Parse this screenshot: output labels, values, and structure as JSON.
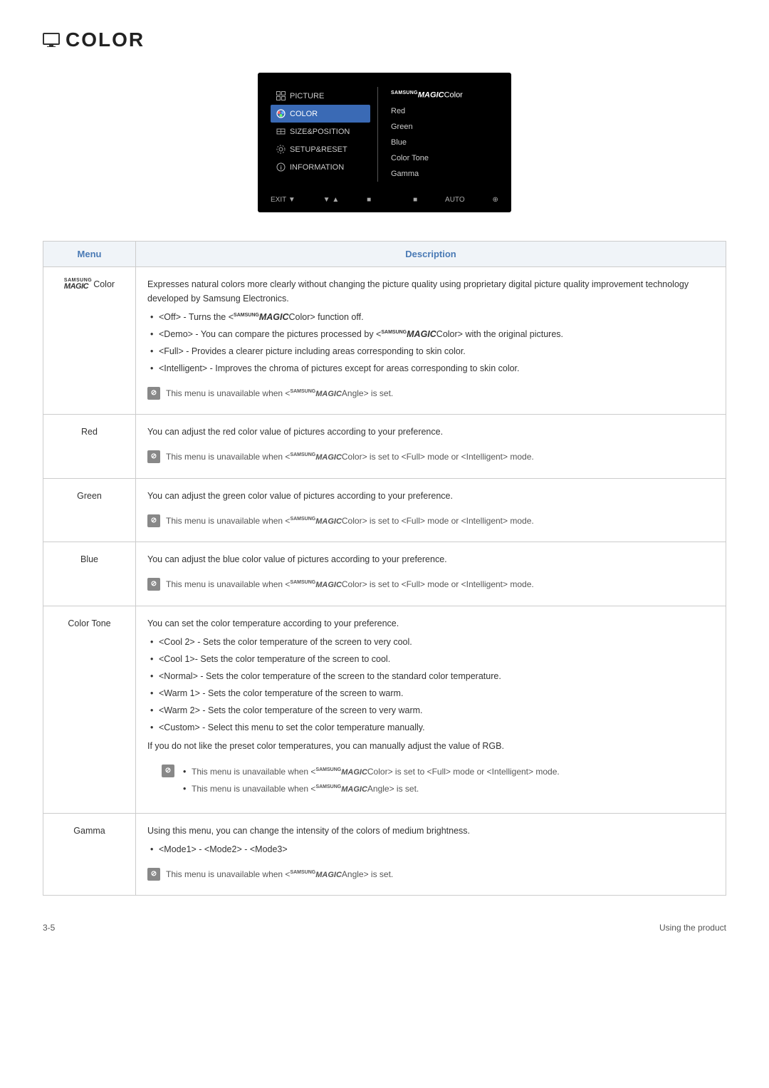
{
  "page": {
    "title": "COLOR",
    "footer_left": "3-5",
    "footer_right": "Using the product"
  },
  "osd": {
    "menu_items": [
      {
        "label": "PICTURE",
        "active": false,
        "icon": "grid"
      },
      {
        "label": "COLOR",
        "active": true,
        "icon": "color"
      },
      {
        "label": "SIZE&POSITION",
        "active": false,
        "icon": "size"
      },
      {
        "label": "SETUP&RESET",
        "active": false,
        "icon": "gear"
      },
      {
        "label": "INFORMATION",
        "active": false,
        "icon": "info"
      }
    ],
    "right_items": [
      {
        "label": "MAGICColor",
        "logo": true
      },
      {
        "label": "Red"
      },
      {
        "label": "Green"
      },
      {
        "label": "Blue"
      },
      {
        "label": "Color Tone"
      },
      {
        "label": "Gamma"
      }
    ]
  },
  "table": {
    "col_menu": "Menu",
    "col_desc": "Description",
    "rows": [
      {
        "menu": "MAGICColor",
        "menu_type": "magic_color",
        "desc_main": "Expresses natural colors more clearly without changing the picture quality using proprietary digital picture quality improvement technology developed by Samsung Electronics.",
        "bullets": [
          "<Off> - Turns the MAGICColor> function off.",
          "<Demo> - You can compare the pictures processed by MAGICColor> with the original pictures.",
          "<Full> - Provides a clearer picture including areas corresponding to skin color.",
          "<Intelligent> - Improves the chroma of pictures except for areas corresponding to skin color."
        ],
        "notes": [
          "This menu is unavailable when < MAGICAngle> is set."
        ]
      },
      {
        "menu": "Red",
        "desc_main": "You can adjust the red color value of pictures according to your preference.",
        "notes": [
          "This menu is unavailable when < MAGICColor> is set to <Full> mode or <Intelligent> mode."
        ]
      },
      {
        "menu": "Green",
        "desc_main": "You can adjust the green color value of pictures according to your preference.",
        "notes": [
          "This menu is unavailable when < MAGICColor> is set to <Full> mode or <Intelligent> mode."
        ]
      },
      {
        "menu": "Blue",
        "desc_main": "You can adjust the blue color value of pictures according to your preference.",
        "notes": [
          "This menu is unavailable when < MAGICColor> is set to <Full> mode or <Intelligent> mode."
        ]
      },
      {
        "menu": "Color Tone",
        "desc_main": "You can set the color temperature according to your preference.",
        "bullets": [
          "<Cool 2> - Sets the color temperature of the screen to very cool.",
          "<Cool 1>- Sets the color temperature of the screen to cool.",
          "<Normal> - Sets the color temperature of the screen to the standard color temperature.",
          "<Warm 1> - Sets the color temperature of the screen to warm.",
          "<Warm 2> - Sets the color temperature of the screen to very warm.",
          "<Custom> - Select this menu to set the color temperature manually."
        ],
        "desc_extra": "If you do not like the preset color temperatures, you can manually adjust the value of RGB.",
        "notes": [
          "This menu is unavailable when < MAGICColor> is set to <Full> mode or <Intelligent> mode.",
          "This menu is unavailable when < MAGICAngle> is set."
        ]
      },
      {
        "menu": "Gamma",
        "desc_main": "Using this menu, you can change the intensity of the colors of medium brightness.",
        "bullets": [
          "<Mode1> - <Mode2> - <Mode3>"
        ],
        "notes": [
          "This menu is unavailable when < MAGICAngle> is set."
        ]
      }
    ]
  }
}
